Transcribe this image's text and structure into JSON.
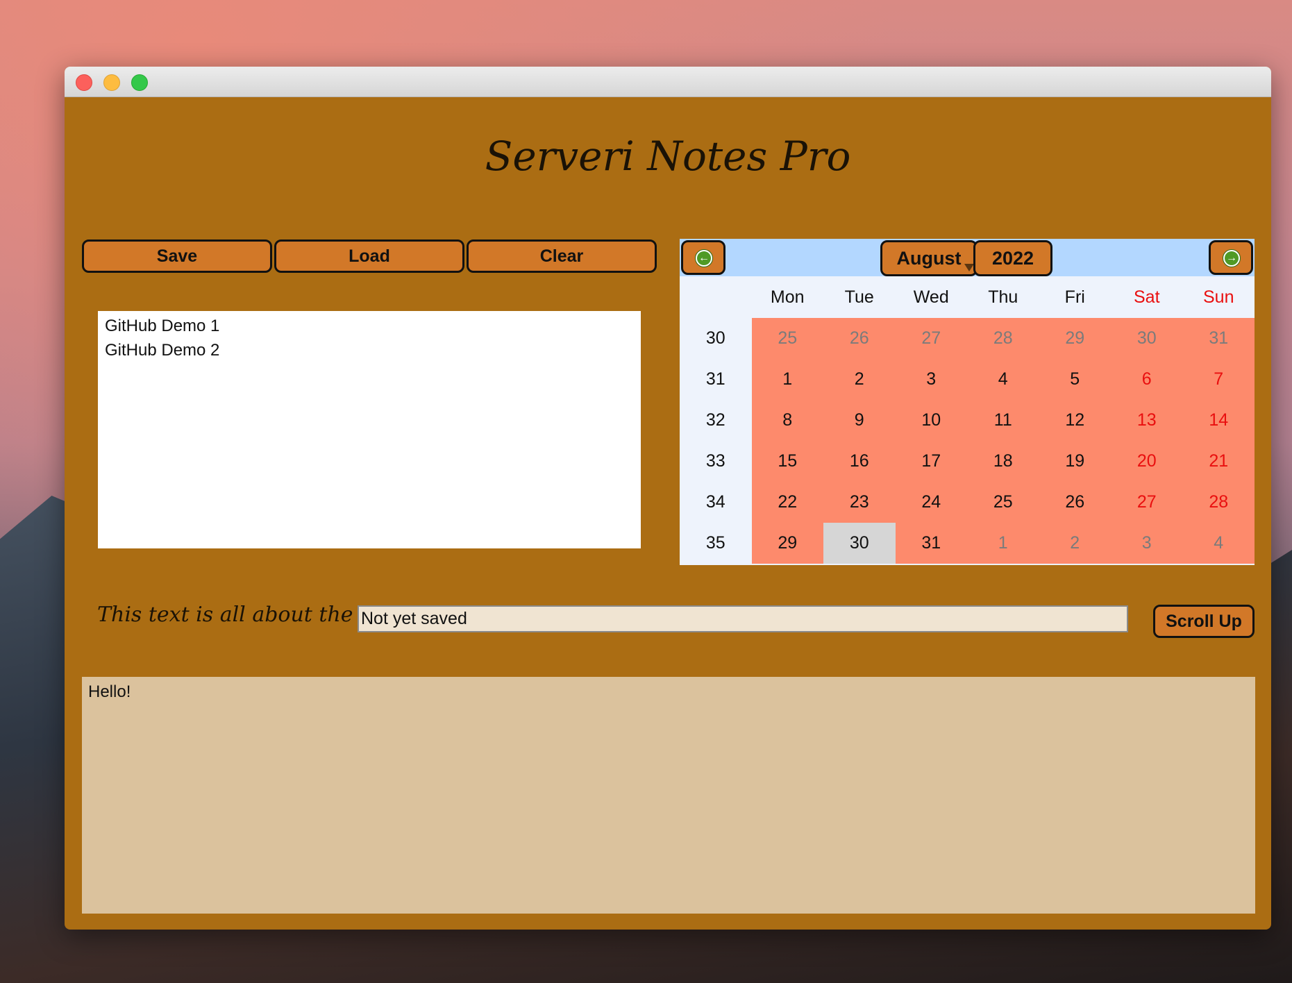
{
  "window": {
    "controls": [
      "close",
      "minimize",
      "zoom"
    ]
  },
  "app": {
    "title": "Serveri Notes Pro"
  },
  "toolbar": {
    "save_label": "Save",
    "load_label": "Load",
    "clear_label": "Clear"
  },
  "notes": {
    "items": [
      "GitHub Demo 1",
      "GitHub Demo 2"
    ]
  },
  "calendar": {
    "month": "August",
    "year": "2022",
    "prev_icon": "arrow-left-icon",
    "next_icon": "arrow-right-icon",
    "weekdays": [
      "Mon",
      "Tue",
      "Wed",
      "Thu",
      "Fri",
      "Sat",
      "Sun"
    ],
    "weeks": [
      {
        "week": "30",
        "days": [
          "25",
          "26",
          "27",
          "28",
          "29",
          "30",
          "31"
        ],
        "other": [
          true,
          true,
          true,
          true,
          true,
          true,
          true
        ]
      },
      {
        "week": "31",
        "days": [
          "1",
          "2",
          "3",
          "4",
          "5",
          "6",
          "7"
        ],
        "other": [
          false,
          false,
          false,
          false,
          false,
          false,
          false
        ]
      },
      {
        "week": "32",
        "days": [
          "8",
          "9",
          "10",
          "11",
          "12",
          "13",
          "14"
        ],
        "other": [
          false,
          false,
          false,
          false,
          false,
          false,
          false
        ]
      },
      {
        "week": "33",
        "days": [
          "15",
          "16",
          "17",
          "18",
          "19",
          "20",
          "21"
        ],
        "other": [
          false,
          false,
          false,
          false,
          false,
          false,
          false
        ]
      },
      {
        "week": "34",
        "days": [
          "22",
          "23",
          "24",
          "25",
          "26",
          "27",
          "28"
        ],
        "other": [
          false,
          false,
          false,
          false,
          false,
          false,
          false
        ]
      },
      {
        "week": "35",
        "days": [
          "29",
          "30",
          "31",
          "1",
          "2",
          "3",
          "4"
        ],
        "other": [
          false,
          false,
          false,
          true,
          true,
          true,
          true
        ]
      }
    ],
    "selected_date": "30",
    "colors": {
      "header_bg": "#b3d7ff",
      "day_bg": "#fd8a6c",
      "weekend_text": "#e90f0f",
      "other_month_text": "#7b7b7b",
      "selected_bg": "#d6d6d6"
    }
  },
  "topic": {
    "label": "This text is all about the",
    "value": "Not yet saved"
  },
  "scroll_up_label": "Scroll Up",
  "note_body": "Hello!",
  "colors": {
    "window_bg": "#ab6d13",
    "button_bg": "#d27828",
    "text_area_bg": "#dbc29d",
    "input_bg": "#f0e4d2"
  }
}
